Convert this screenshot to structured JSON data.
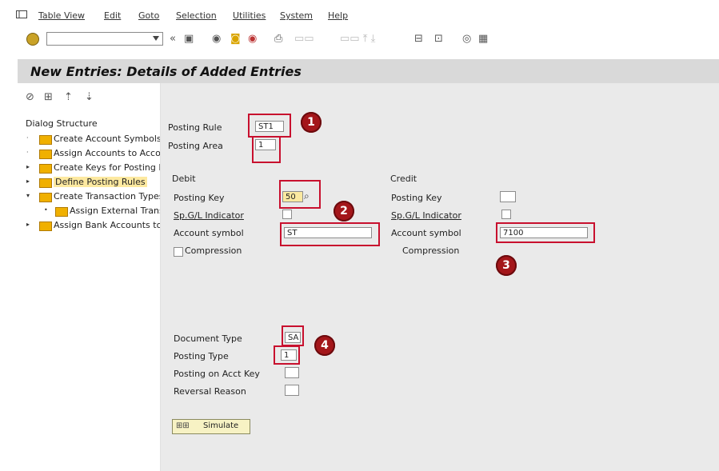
{
  "menu": [
    "Table View",
    "Edit",
    "Goto",
    "Selection",
    "Utilities",
    "System",
    "Help"
  ],
  "toolbar": {
    "command_placeholder": ""
  },
  "page_title": "New Entries: Details of Added Entries",
  "left": {
    "dialog_structure": "Dialog Structure",
    "tree": [
      {
        "label": "Create Account Symbols",
        "arrow": "·",
        "level": 0,
        "selected": false
      },
      {
        "label": "Assign Accounts to Account Symbols",
        "arrow": "·",
        "level": 0,
        "selected": false
      },
      {
        "label": "Create Keys for Posting Rules",
        "arrow": "▸",
        "level": 0,
        "selected": false
      },
      {
        "label": "Define Posting Rules",
        "arrow": "▸",
        "level": 0,
        "selected": true
      },
      {
        "label": "Create Transaction Types",
        "arrow": "▾",
        "level": 0,
        "selected": false
      },
      {
        "label": "Assign External Transaction Types",
        "arrow": "•",
        "level": 1,
        "selected": false
      },
      {
        "label": "Assign Bank Accounts to Transaction Types",
        "arrow": "▸",
        "level": 0,
        "selected": false
      }
    ]
  },
  "form": {
    "posting_rule_label": "Posting Rule",
    "posting_rule_value": "ST1",
    "posting_area_label": "Posting Area",
    "posting_area_value": "1",
    "debit_title": "Debit",
    "credit_title": "Credit",
    "debit_posting_key_label": "Posting Key",
    "debit_posting_key_value": "50",
    "debit_spgl_label": "Sp.G/L Indicator",
    "debit_account_symbol_label": "Account symbol",
    "debit_account_symbol_value": "ST",
    "debit_compression_label": "Compression",
    "credit_posting_key_label": "Posting Key",
    "credit_spgl_label": "Sp.G/L Indicator",
    "credit_account_symbol_label": "Account symbol",
    "credit_account_symbol_value": "7100",
    "credit_compression_label": "Compression",
    "document_type_label": "Document Type",
    "document_type_value": "SA",
    "posting_type_label": "Posting Type",
    "posting_type_value": "1",
    "posting_on_acct_key_label": "Posting on Acct Key",
    "reversal_reason_label": "Reversal Reason",
    "simulate_label": "Simulate"
  },
  "badges": [
    "1",
    "2",
    "3",
    "4"
  ],
  "colors": {
    "annotation_red": "#c8102e",
    "badge": "#a4161a",
    "folder": "#f0b000",
    "title_bg": "#d9d9d9",
    "panel_bg": "#eaeaea"
  }
}
